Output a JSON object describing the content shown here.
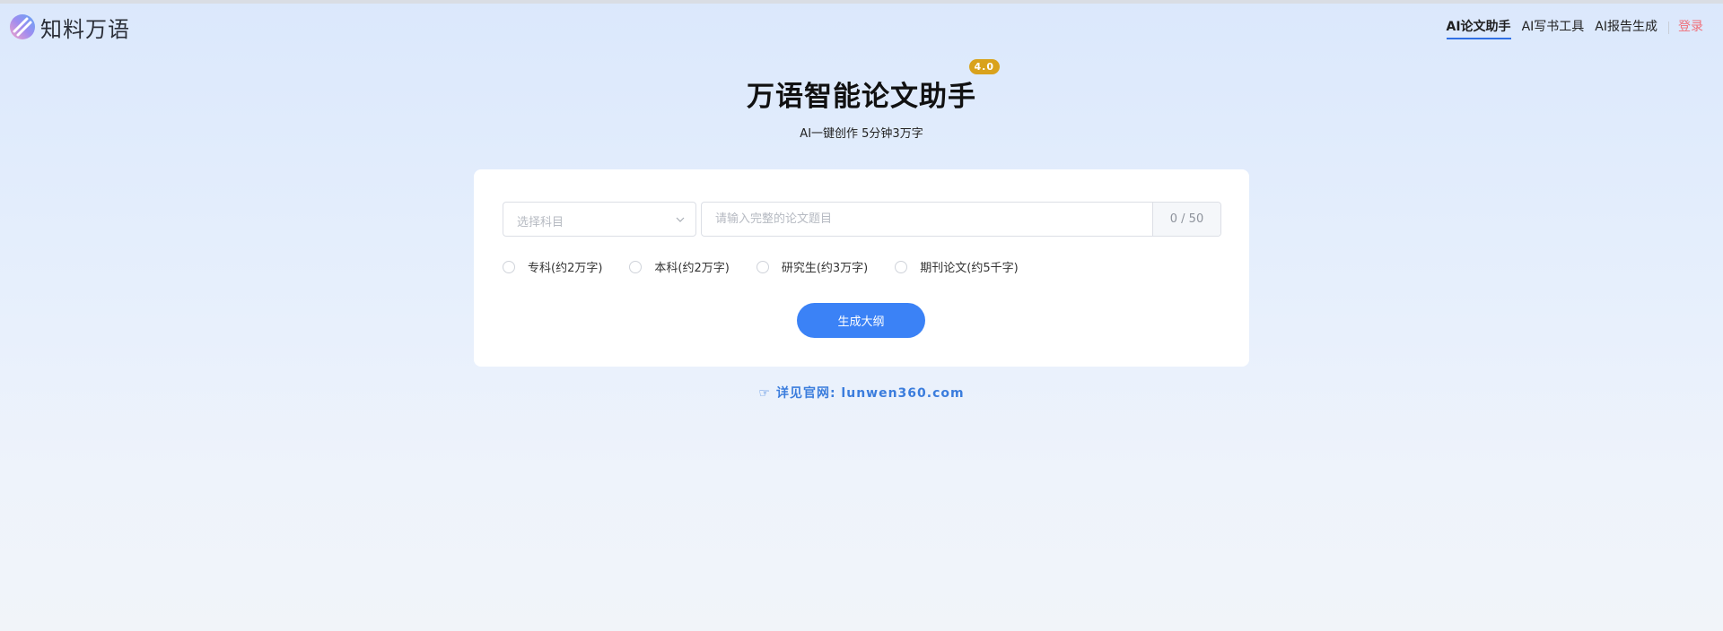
{
  "header": {
    "logo_text": "知料万语",
    "nav": [
      {
        "label": "AI论文助手",
        "active": true
      },
      {
        "label": "AI写书工具",
        "active": false
      },
      {
        "label": "AI报告生成",
        "active": false
      }
    ],
    "login_label": "登录"
  },
  "hero": {
    "title": "万语智能论文助手",
    "version": "4.0",
    "subtitle": "AI一键创作 5分钟3万字"
  },
  "form": {
    "subject_placeholder": "选择科目",
    "title_placeholder": "请输入完整的论文题目",
    "char_count": "0 / 50",
    "degree_options": [
      {
        "label": "专科(约2万字)",
        "selected": false
      },
      {
        "label": "本科(约2万字)",
        "selected": false
      },
      {
        "label": "研究生(约3万字)",
        "selected": false
      },
      {
        "label": "期刊论文(约5千字)",
        "selected": false
      }
    ],
    "generate_label": "生成大纲"
  },
  "footer_link": {
    "icon": "pointing-hand-icon",
    "text": "详见官网: lunwen360.com"
  },
  "colors": {
    "accent": "#3b82f6",
    "badge": "#d9a21c",
    "login": "#f0707a",
    "link": "#3b7ddd"
  }
}
